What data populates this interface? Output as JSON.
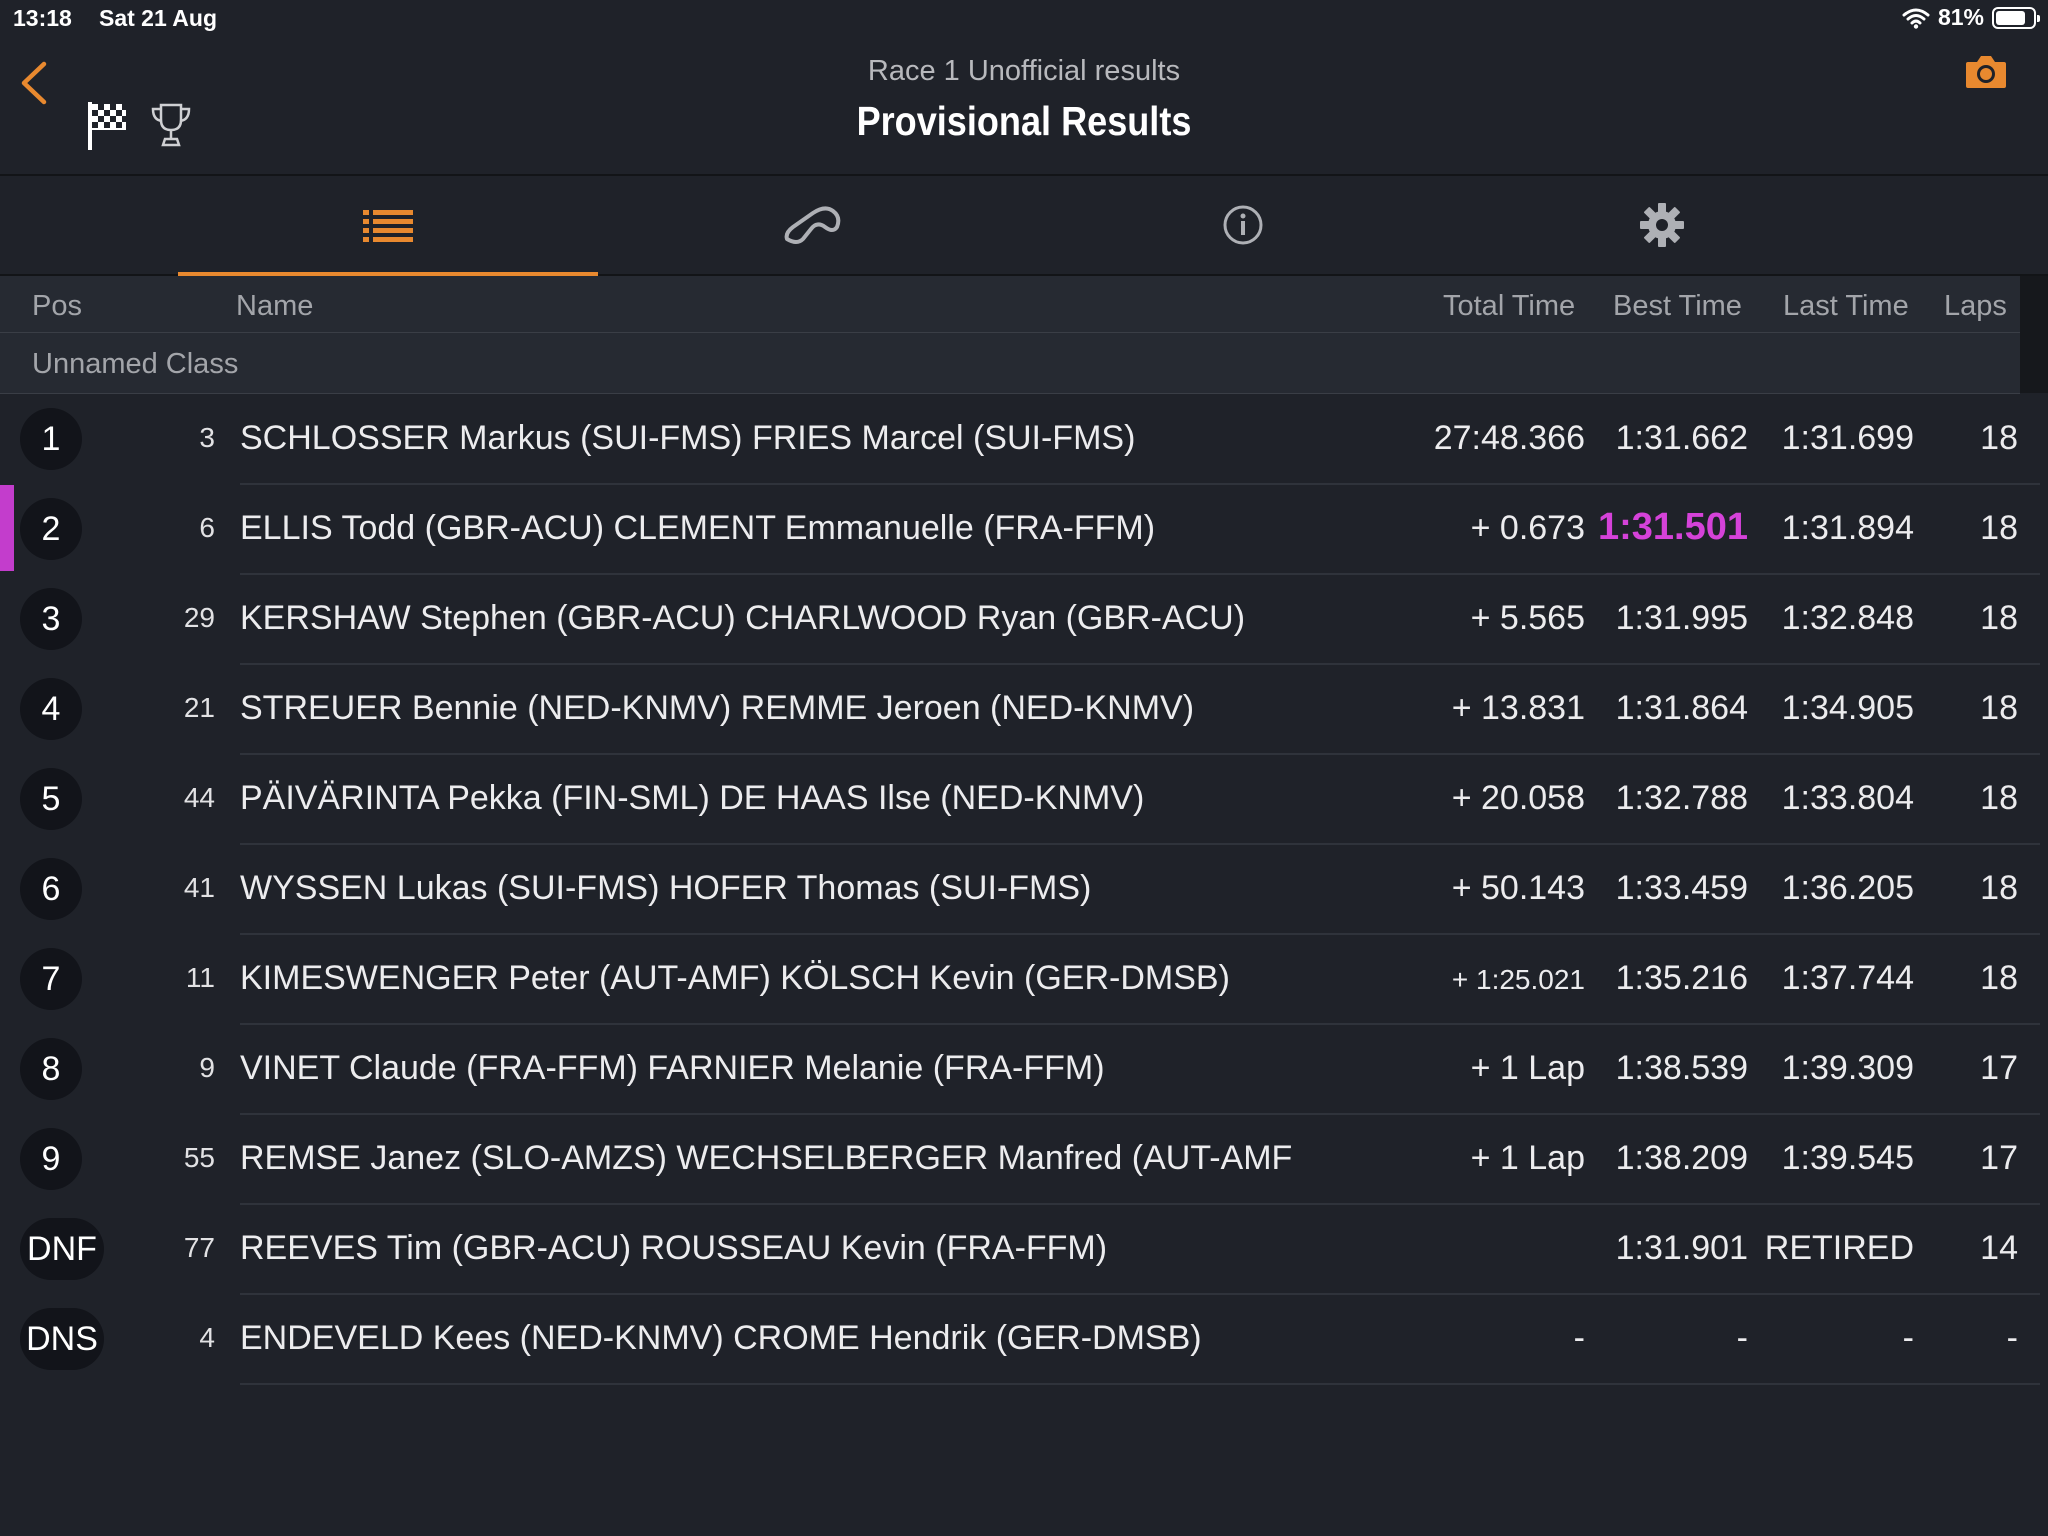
{
  "status_bar": {
    "time": "13:18",
    "date": "Sat 21 Aug",
    "battery": "81%",
    "battery_level": 0.81
  },
  "header": {
    "subtitle": "Race 1 Unofficial results",
    "title": "Provisional Results"
  },
  "tabs": [
    {
      "icon": "list-icon",
      "active": true
    },
    {
      "icon": "track-icon",
      "active": false
    },
    {
      "icon": "info-icon",
      "active": false
    },
    {
      "icon": "gear-icon",
      "active": false
    }
  ],
  "columns": {
    "pos": "Pos",
    "name": "Name",
    "total": "Total Time",
    "best": "Best Time",
    "last": "Last Time",
    "laps": "Laps"
  },
  "class_name": "Unnamed Class",
  "accent_color": "#e8892f",
  "fastest_color": "#d542d9",
  "rows": [
    {
      "pos": "1",
      "num": "3",
      "name": "SCHLOSSER Markus (SUI-FMS) FRIES Marcel (SUI-FMS)",
      "total": "27:48.366",
      "best": "1:31.662",
      "last": "1:31.699",
      "laps": "18"
    },
    {
      "pos": "2",
      "num": "6",
      "name": "ELLIS Todd (GBR-ACU) CLEMENT Emmanuelle (FRA-FFM)",
      "total": "+ 0.673",
      "best": "1:31.501",
      "last": "1:31.894",
      "laps": "18",
      "fastest": true
    },
    {
      "pos": "3",
      "num": "29",
      "name": "KERSHAW Stephen (GBR-ACU) CHARLWOOD Ryan (GBR-ACU)",
      "total": "+ 5.565",
      "best": "1:31.995",
      "last": "1:32.848",
      "laps": "18"
    },
    {
      "pos": "4",
      "num": "21",
      "name": "STREUER Bennie (NED-KNMV) REMME Jeroen  (NED-KNMV)",
      "total": "+ 13.831",
      "best": "1:31.864",
      "last": "1:34.905",
      "laps": "18"
    },
    {
      "pos": "5",
      "num": "44",
      "name": "PÄIVÄRINTA Pekka (FIN-SML) DE HAAS Ilse (NED-KNMV)",
      "total": "+ 20.058",
      "best": "1:32.788",
      "last": "1:33.804",
      "laps": "18"
    },
    {
      "pos": "6",
      "num": "41",
      "name": "WYSSEN Lukas (SUI-FMS) HOFER Thomas (SUI-FMS)",
      "total": "+ 50.143",
      "best": "1:33.459",
      "last": "1:36.205",
      "laps": "18"
    },
    {
      "pos": "7",
      "num": "11",
      "name": "KIMESWENGER Peter (AUT-AMF) KÖLSCH Kevin (GER-DMSB)",
      "total": "+ 1:25.021",
      "best": "1:35.216",
      "last": "1:37.744",
      "laps": "18",
      "small_total": true
    },
    {
      "pos": "8",
      "num": "9",
      "name": "VINET Claude (FRA-FFM) FARNIER Melanie (FRA-FFM)",
      "total": "+ 1 Lap",
      "best": "1:38.539",
      "last": "1:39.309",
      "laps": "17"
    },
    {
      "pos": "9",
      "num": "55",
      "name": "REMSE Janez (SLO-AMZS) WECHSELBERGER Manfred (AUT-AMF",
      "total": "+ 1 Lap",
      "best": "1:38.209",
      "last": "1:39.545",
      "laps": "17"
    },
    {
      "pos": "DNF",
      "num": "77",
      "name": "REEVES Tim (GBR-ACU) ROUSSEAU Kevin (FRA-FFM)",
      "total": "",
      "best": "1:31.901",
      "last": "RETIRED",
      "laps": "14"
    },
    {
      "pos": "DNS",
      "num": "4",
      "name": "ENDEVELD Kees (NED-KNMV) CROME Hendrik (GER-DMSB)",
      "total": "-",
      "best": "-",
      "last": "-",
      "laps": "-"
    }
  ]
}
